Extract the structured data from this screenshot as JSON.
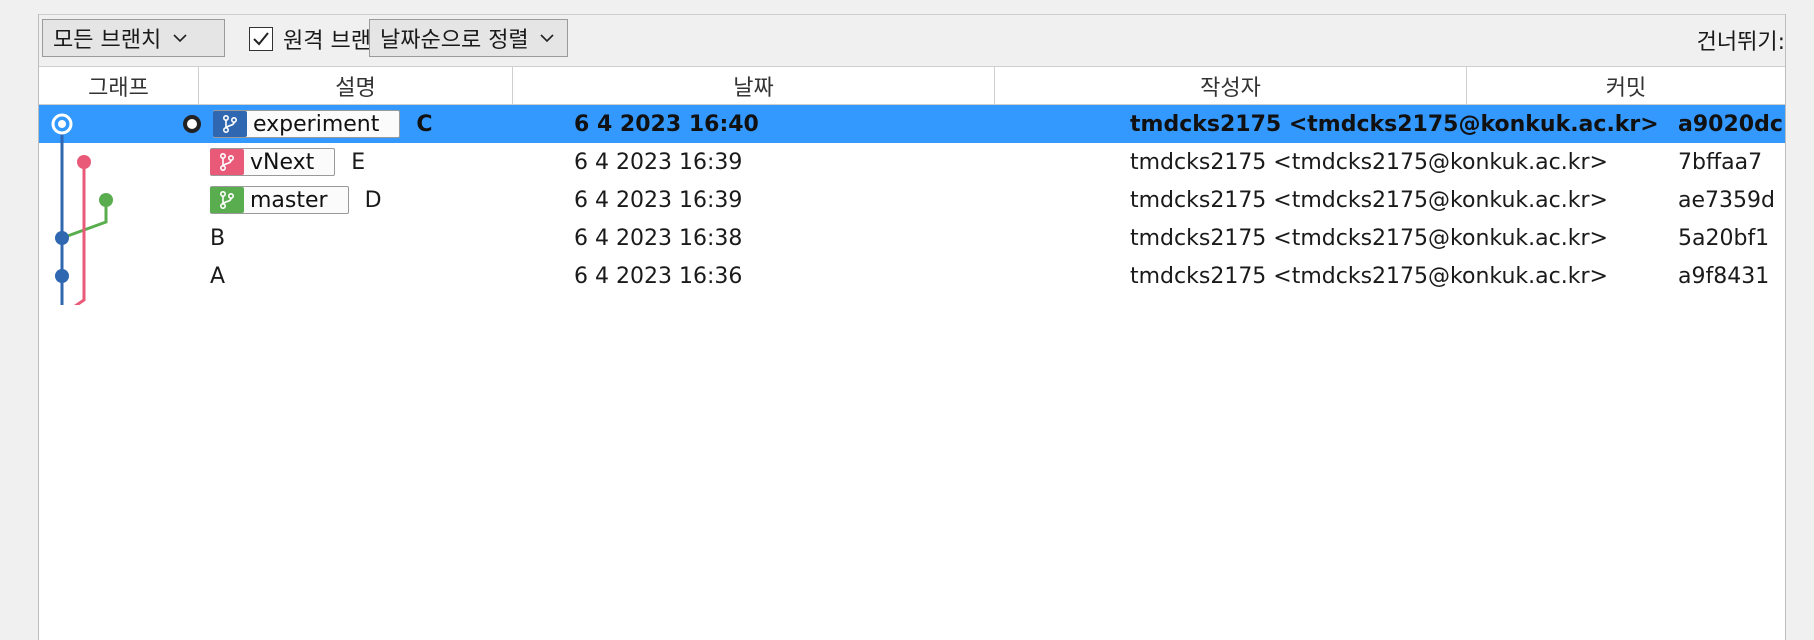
{
  "toolbar": {
    "branch_filter": "모든 브랜치",
    "remote_branches_label": "원격 브랜치",
    "remote_branches_checked": true,
    "sort_order": "날짜순으로 정렬",
    "skip_label": "건너뛰기:"
  },
  "columns": {
    "graph": "그래프",
    "description": "설명",
    "date": "날짜",
    "author": "작성자",
    "commit": "커밋"
  },
  "colors": {
    "selection": "#3399ff",
    "branch_experiment": "#2f67b1",
    "branch_vnext": "#e85a78",
    "branch_master": "#5aad4e"
  },
  "commits": [
    {
      "message": "C",
      "date": "6 4 2023 16:40",
      "author": "tmdcks2175  <tmdcks2175@konkuk.ac.kr>",
      "hash": "a9020dc",
      "branch": "experiment",
      "branch_icon": "branch-icon",
      "is_head": true,
      "selected": true
    },
    {
      "message": "E",
      "date": "6 4 2023 16:39",
      "author": "tmdcks2175  <tmdcks2175@konkuk.ac.kr>",
      "hash": "7bffaa7",
      "branch": "vNext",
      "branch_icon": "branch-icon"
    },
    {
      "message": "D",
      "date": "6 4 2023 16:39",
      "author": "tmdcks2175  <tmdcks2175@konkuk.ac.kr>",
      "hash": "ae7359d",
      "branch": "master",
      "branch_icon": "branch-icon"
    },
    {
      "message": "B",
      "date": "6 4 2023 16:38",
      "author": "tmdcks2175  <tmdcks2175@konkuk.ac.kr>",
      "hash": "5a20bf1"
    },
    {
      "message": "A",
      "date": "6 4 2023 16:36",
      "author": "tmdcks2175  <tmdcks2175@konkuk.ac.kr>",
      "hash": "a9f8431"
    }
  ]
}
